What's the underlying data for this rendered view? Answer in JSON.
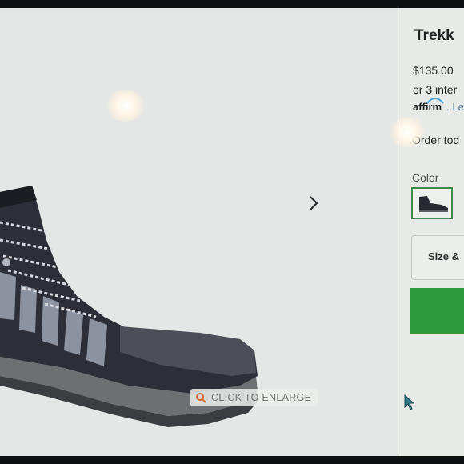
{
  "gallery": {
    "enlarge_label": "CLICK TO ENLARGE",
    "next_icon": "chevron-right-icon",
    "search_icon": "magnifier-icon"
  },
  "product": {
    "title": "Trekk",
    "price": "$135.00",
    "installments": "or 3 inter",
    "affirm_logo": "affirm",
    "affirm_suffix": ". Le",
    "order_text": "Order tod",
    "color_label": "Color",
    "size_button_label": "Size &"
  },
  "colors": {
    "accent_green": "#2c9a3d",
    "swatch_border": "#3a8a4a",
    "link_blue": "#5a7fa8"
  }
}
